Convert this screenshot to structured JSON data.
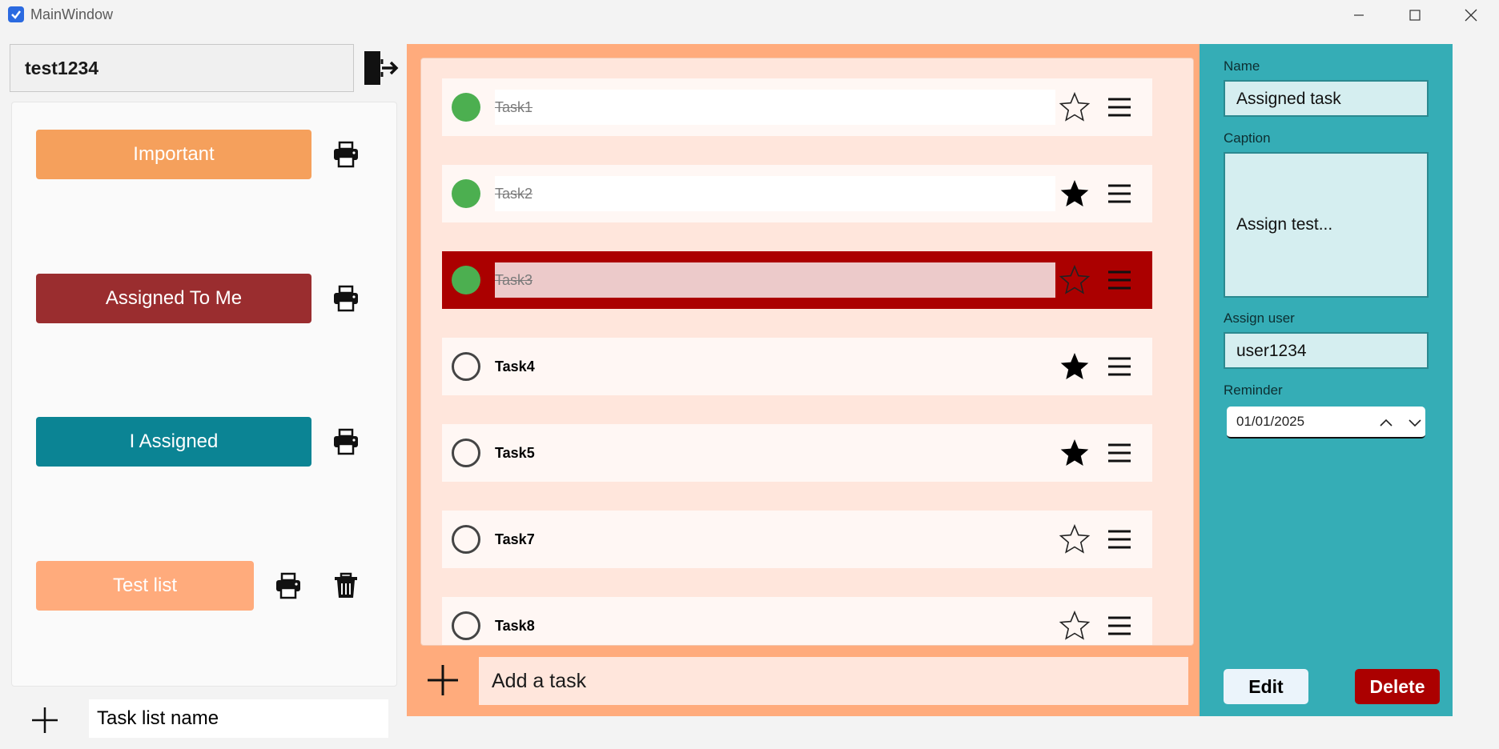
{
  "window": {
    "title": "MainWindow"
  },
  "user": {
    "name": "test1234"
  },
  "task_lists": [
    {
      "label": "Important",
      "color": "#f5a05c"
    },
    {
      "label": "Assigned To Me",
      "color": "#9a2d2f"
    },
    {
      "label": "I Assigned",
      "color": "#0b8494"
    },
    {
      "label": "Test list",
      "color": "#ffab7c"
    }
  ],
  "new_list": {
    "value": "Task list name"
  },
  "tasks": [
    {
      "name": "Task1",
      "completed": true,
      "starred": false,
      "selected": false
    },
    {
      "name": "Task2",
      "completed": true,
      "starred": true,
      "selected": false
    },
    {
      "name": "Task3",
      "completed": true,
      "starred": false,
      "selected": true
    },
    {
      "name": "Task4",
      "completed": false,
      "starred": true,
      "selected": false
    },
    {
      "name": "Task5",
      "completed": false,
      "starred": true,
      "selected": false
    },
    {
      "name": "Task7",
      "completed": false,
      "starred": false,
      "selected": false
    },
    {
      "name": "Task8",
      "completed": false,
      "starred": false,
      "selected": false
    }
  ],
  "add_task": {
    "placeholder": "Add a task"
  },
  "details": {
    "name_label": "Name",
    "name_value": "Assigned task",
    "caption_label": "Caption",
    "caption_value": "Assign test...",
    "assign_label": "Assign user",
    "assign_value": "user1234",
    "reminder_label": "Reminder",
    "reminder_value": "01/01/2025",
    "edit_label": "Edit",
    "delete_label": "Delete"
  },
  "colors": {
    "middle_background": "#ffab7c",
    "details_background": "#35adb6",
    "selected_task": "#ab0000",
    "completed_circle": "#4caf50"
  }
}
